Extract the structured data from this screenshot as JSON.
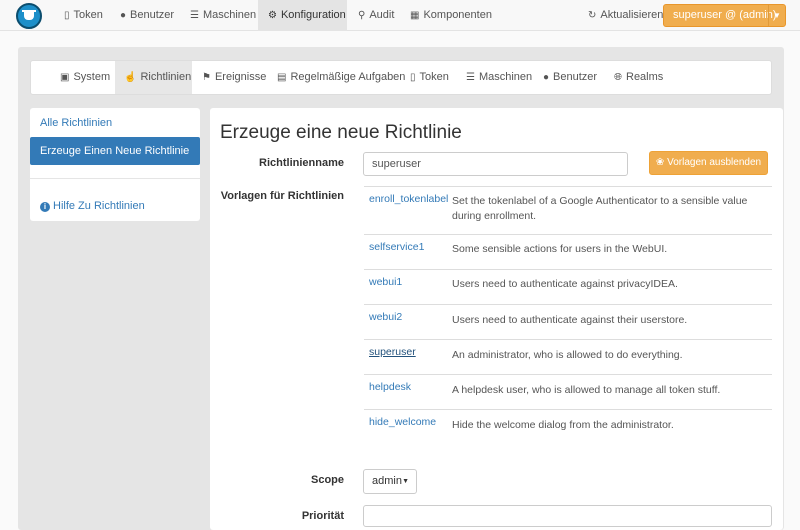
{
  "topnav": {
    "items": [
      {
        "label": "Token",
        "icon": "mobile-icon"
      },
      {
        "label": "Benutzer",
        "icon": "user-icon"
      },
      {
        "label": "Maschinen",
        "icon": "tasks-icon"
      },
      {
        "label": "Konfiguration",
        "icon": "cog-icon",
        "active": true
      },
      {
        "label": "Audit",
        "icon": "search-icon"
      },
      {
        "label": "Komponenten",
        "icon": "grid-icon"
      }
    ],
    "refresh_label": "Aktualisieren",
    "user_label": "superuser @ (admin)"
  },
  "subnav": {
    "items": [
      {
        "label": "System"
      },
      {
        "label": "Richtlinien",
        "active": true
      },
      {
        "label": "Ereignisse"
      },
      {
        "label": "Regelmäßige Aufgaben"
      },
      {
        "label": "Token"
      },
      {
        "label": "Maschinen"
      },
      {
        "label": "Benutzer"
      },
      {
        "label": "Realms"
      }
    ]
  },
  "sidebar": {
    "all_policies": "Alle Richtlinien",
    "create_policy": "Erzeuge Einen Neue Richtlinie",
    "help": "Hilfe Zu Richtlinien"
  },
  "main": {
    "title": "Erzeuge eine neue Richtlinie",
    "policy_name_label": "Richtlinienname",
    "policy_name_value": "superuser",
    "hide_templates_button": "Vorlagen ausblenden",
    "templates_label": "Vorlagen für Richtlinien",
    "templates": [
      {
        "name": "enroll_tokenlabel",
        "desc": "Set the tokenlabel of a Google Authenticator to a sensible value during enrollment."
      },
      {
        "name": "selfservice1",
        "desc": "Some sensible actions for users in the WebUI."
      },
      {
        "name": "webui1",
        "desc": "Users need to authenticate against privacyIDEA."
      },
      {
        "name": "webui2",
        "desc": "Users need to authenticate against their userstore."
      },
      {
        "name": "superuser",
        "desc": "An administrator, who is allowed to do everything."
      },
      {
        "name": "helpdesk",
        "desc": "A helpdesk user, who is allowed to manage all token stuff."
      },
      {
        "name": "hide_welcome",
        "desc": "Hide the welcome dialog from the administrator."
      }
    ],
    "scope_label": "Scope",
    "scope_value": "admin",
    "priority_label": "Priorität",
    "priority_value": ""
  },
  "colors": {
    "primary": "#337ab7",
    "warning": "#f0ad4e"
  }
}
